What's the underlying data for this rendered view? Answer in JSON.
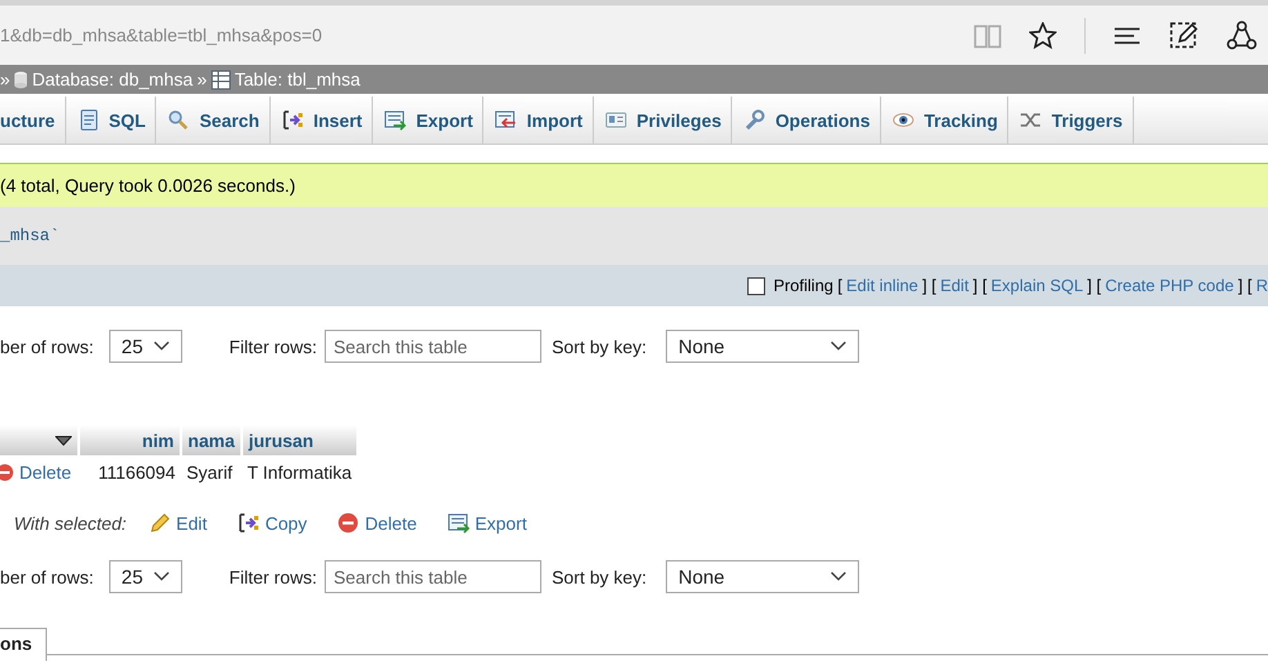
{
  "browser": {
    "url": "1&db=db_mhsa&table=tbl_mhsa&pos=0"
  },
  "breadcrumb": [
    {
      "kind": "separator",
      "text": "»"
    },
    {
      "kind": "database",
      "text": "Database: db_mhsa"
    },
    {
      "kind": "separator",
      "text": "»"
    },
    {
      "kind": "table",
      "text": "Table: tbl_mhsa"
    }
  ],
  "tabs": [
    {
      "kind": "structure",
      "label": "ucture",
      "selected": false
    },
    {
      "kind": "sql",
      "label": "SQL",
      "selected": false
    },
    {
      "kind": "search",
      "label": "Search",
      "selected": false
    },
    {
      "kind": "insert",
      "label": "Insert",
      "selected": false
    },
    {
      "kind": "export",
      "label": "Export",
      "selected": false
    },
    {
      "kind": "import",
      "label": "Import",
      "selected": false
    },
    {
      "kind": "privileges",
      "label": "Privileges",
      "selected": false
    },
    {
      "kind": "operations",
      "label": "Operations",
      "selected": false
    },
    {
      "kind": "tracking",
      "label": "Tracking",
      "selected": false
    },
    {
      "kind": "triggers",
      "label": "Triggers",
      "selected": false
    }
  ],
  "message": "(4 total, Query took 0.0026 seconds.)",
  "sql_query": "_mhsa`",
  "profiling": {
    "checked": false,
    "label": "Profiling",
    "segments": [
      {
        "kind": "bracket",
        "text": "["
      },
      {
        "kind": "link",
        "text": "Edit inline"
      },
      {
        "kind": "bracket",
        "text": "] ["
      },
      {
        "kind": "link",
        "text": "Edit"
      },
      {
        "kind": "bracket",
        "text": "] ["
      },
      {
        "kind": "link",
        "text": "Explain SQL"
      },
      {
        "kind": "bracket",
        "text": "] ["
      },
      {
        "kind": "link",
        "text": "Create PHP code"
      },
      {
        "kind": "bracket",
        "text": "] ["
      },
      {
        "kind": "link",
        "text": "R"
      }
    ]
  },
  "controls_top": {
    "rows_label": "ber of rows:",
    "rows_value": "25",
    "filter_label": "Filter rows:",
    "filter_placeholder": "Search this table",
    "sort_label": "Sort by key:",
    "sort_value": "None"
  },
  "table": {
    "columns": [
      {
        "kind": "menu"
      },
      {
        "kind": "text",
        "label": "nim"
      },
      {
        "kind": "text",
        "label": "nama"
      },
      {
        "kind": "text",
        "label": "jurusan"
      }
    ],
    "rows": [
      {
        "cells": [
          "Delete",
          "11166094",
          "Syarif",
          "T Informatika"
        ]
      }
    ]
  },
  "with_selected": {
    "label": "With selected:",
    "actions": [
      {
        "kind": "edit",
        "label": "Edit"
      },
      {
        "kind": "copy",
        "label": "Copy"
      },
      {
        "kind": "delete",
        "label": "Delete"
      },
      {
        "kind": "export",
        "label": "Export"
      }
    ]
  },
  "controls_bottom": {
    "rows_label": "ber of rows:",
    "rows_value": "25",
    "filter_label": "Filter rows:",
    "filter_placeholder": "Search this table",
    "sort_label": "Sort by key:",
    "sort_value": "None"
  },
  "bottom_tab": {
    "label": "ons"
  }
}
